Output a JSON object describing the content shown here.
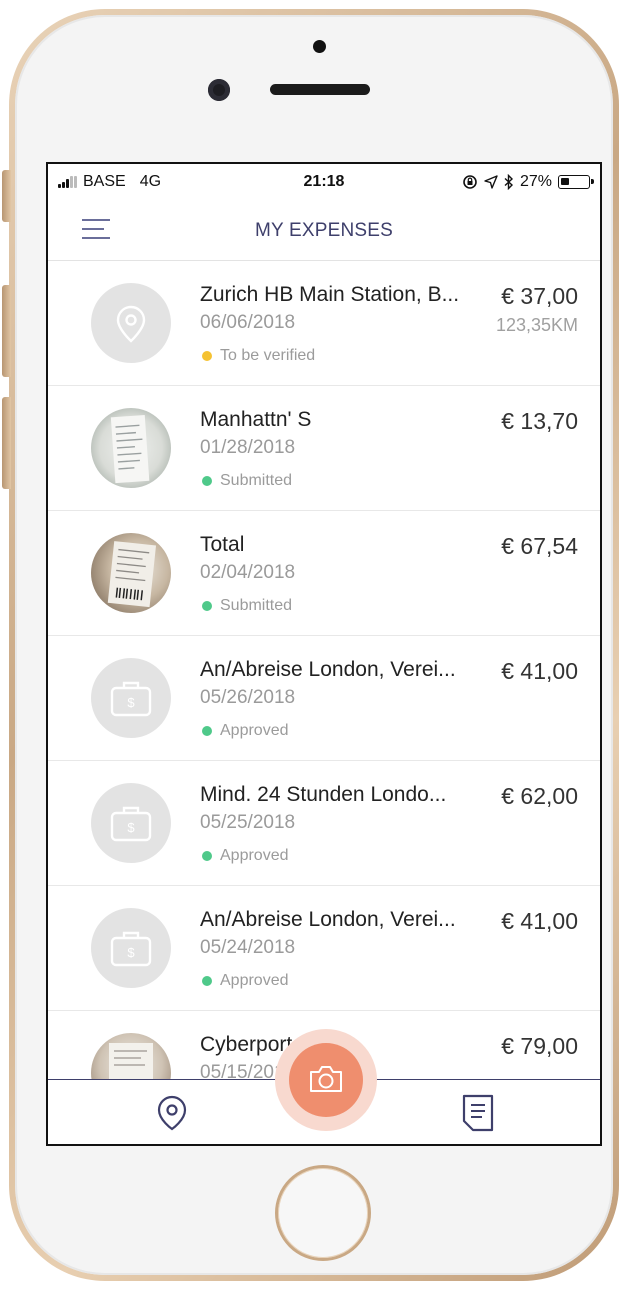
{
  "status_bar": {
    "carrier": "BASE",
    "network": "4G",
    "time": "21:18",
    "battery": "27%"
  },
  "nav": {
    "title": "MY EXPENSES"
  },
  "colors": {
    "accent": "#3e3f6b",
    "camera": "#ef8e6e",
    "status_yellow": "#f5c232",
    "status_green": "#4fc98a"
  },
  "expenses": [
    {
      "title": "Zurich HB Main Station, B...",
      "date": "06/06/2018",
      "status": "To be verified",
      "amount": "€ 37,00",
      "distance": "123,35KM",
      "thumb": "location-icon"
    },
    {
      "title": "Manhattn' S",
      "date": "01/28/2018",
      "status": "Submitted",
      "amount": "€ 13,70",
      "thumb": "receipt-photo"
    },
    {
      "title": "Total",
      "date": "02/04/2018",
      "status": "Submitted",
      "amount": "€ 67,54",
      "thumb": "receipt-photo"
    },
    {
      "title": "An/Abreise London, Verei...",
      "date": "05/26/2018",
      "status": "Approved",
      "amount": "€ 41,00",
      "thumb": "briefcase-icon"
    },
    {
      "title": "Mind. 24 Stunden Londo...",
      "date": "05/25/2018",
      "status": "Approved",
      "amount": "€ 62,00",
      "thumb": "briefcase-icon"
    },
    {
      "title": "An/Abreise London, Verei...",
      "date": "05/24/2018",
      "status": "Approved",
      "amount": "€ 41,00",
      "thumb": "briefcase-icon"
    },
    {
      "title": "Cyberport",
      "date": "05/15/2018",
      "status": "",
      "amount": "€ 79,00",
      "thumb": "receipt-photo"
    }
  ],
  "tabbar": {
    "left_icon": "location-pin-icon",
    "center_icon": "camera-icon",
    "right_icon": "document-icon"
  }
}
